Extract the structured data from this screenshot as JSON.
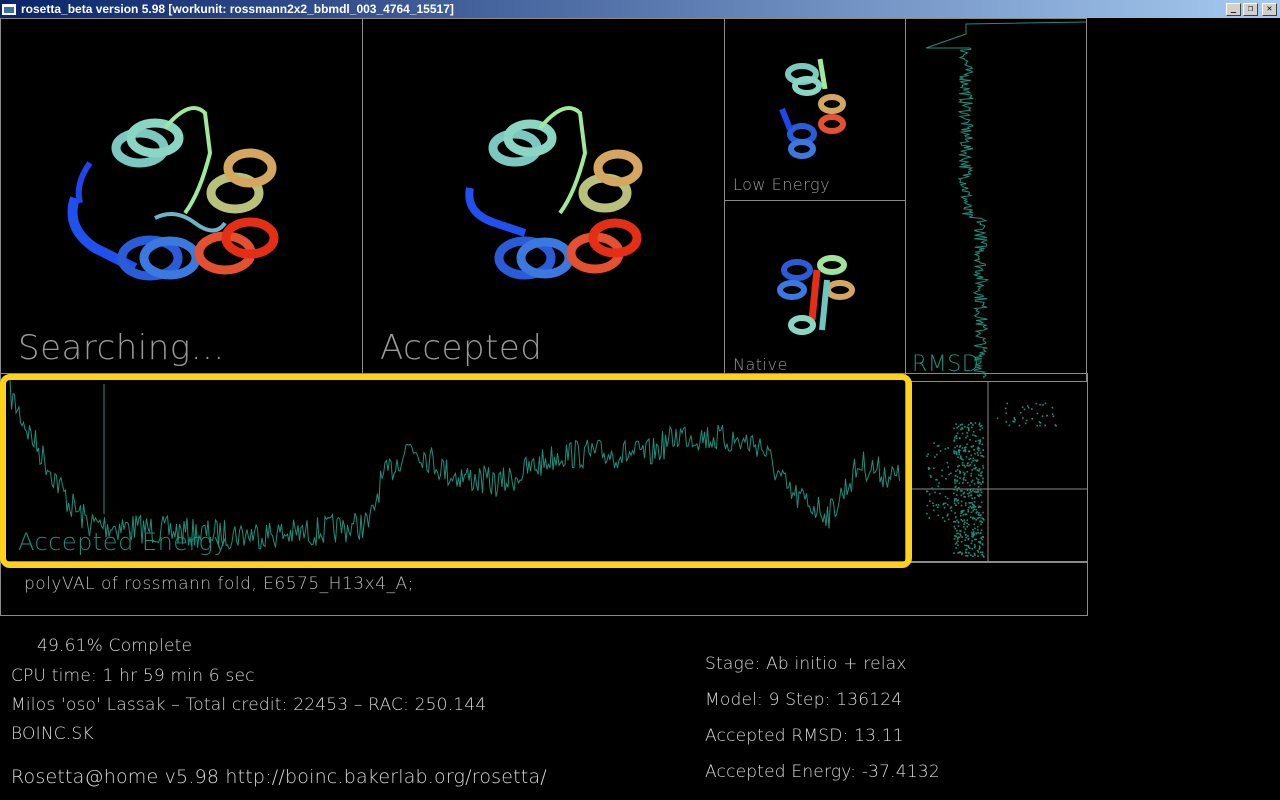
{
  "window": {
    "title": "rosetta_beta version 5.98 [workunit: rossmann2x2_bbmdl_003_4764_15517]",
    "buttons": [
      "_",
      "❐",
      "✕"
    ]
  },
  "panels": {
    "searching": "Searching...",
    "accepted": "Accepted",
    "low_energy": "Low  Energy",
    "native": "Native",
    "rmsd": "RMSD",
    "accepted_energy": "Accepted  Energy"
  },
  "description": "polyVAL  of  rossmann  fold,  E6575_H13x4_A;",
  "status": {
    "complete": "49.61%  Complete",
    "cpu_time": "CPU  time:  1  hr  59  min  6  sec",
    "user_line": "Milos  'oso'  Lassak  –  Total  credit:  22453  –  RAC:  250.144",
    "team": "BOINC.SK",
    "footer": "Rosetta@home   v5.98   http://boinc.bakerlab.org/rosetta/",
    "stage": "Stage:  Ab  initio  +  relax",
    "model_step": "Model:  9     Step:  136124",
    "accepted_rmsd": "Accepted  RMSD:     13.11",
    "accepted_energy": "Accepted  Energy:   -37.4132"
  },
  "colors": {
    "trace": "#1f8f7a",
    "highlight": "#ffd21a",
    "frame": "#8a8a8a"
  }
}
